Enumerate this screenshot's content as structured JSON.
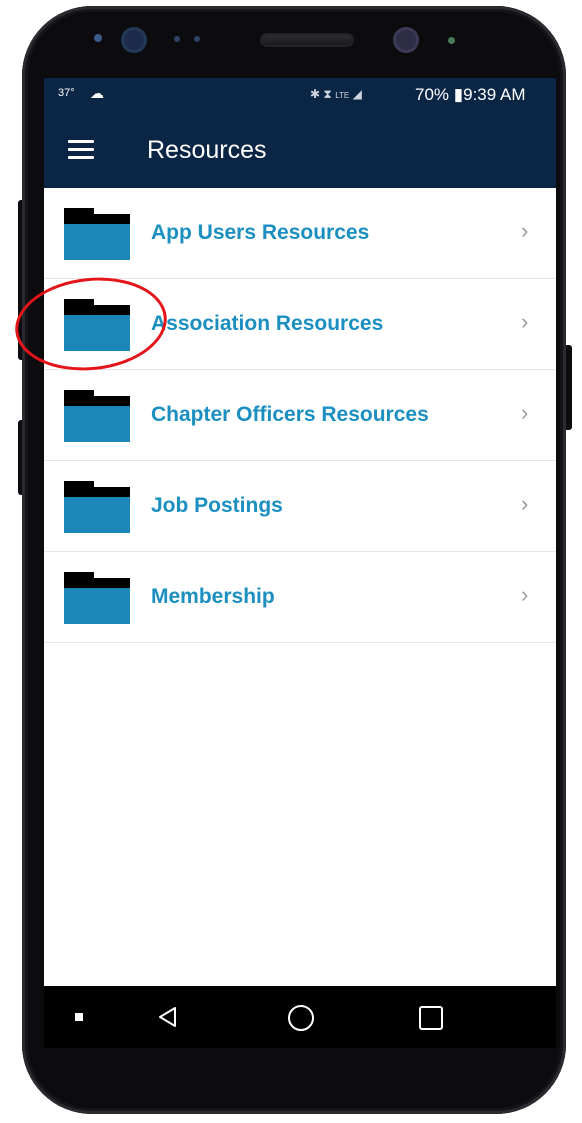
{
  "status_bar": {
    "temperature": "37°",
    "battery": "70%",
    "time": "9:39 AM",
    "icon_names": [
      "weather-cloud-icon",
      "bluetooth-icon",
      "alarm-icon",
      "lte-icon",
      "signal-icon",
      "battery-icon"
    ]
  },
  "app_bar": {
    "title": "Resources",
    "menu_icon": "hamburger-menu-icon",
    "background": "#0b2545"
  },
  "resources": [
    {
      "label": "App Users Resources",
      "icon": "folder-icon"
    },
    {
      "label": "Association Resources",
      "icon": "folder-icon"
    },
    {
      "label": "Chapter Officers Resources",
      "icon": "folder-icon"
    },
    {
      "label": "Job Postings",
      "icon": "folder-icon"
    },
    {
      "label": "Membership",
      "icon": "folder-icon"
    }
  ],
  "nav_bar": {
    "buttons": [
      "dot-icon",
      "back-icon",
      "home-icon",
      "recent-apps-icon"
    ]
  },
  "colors": {
    "accent": "#1a8fc0",
    "folder": "#1b87b8",
    "highlight": "#e3151a"
  }
}
